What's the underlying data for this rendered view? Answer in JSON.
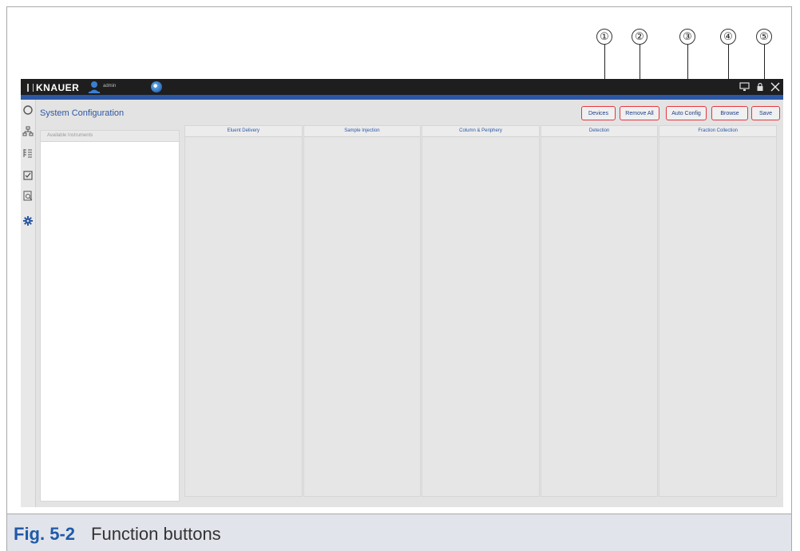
{
  "callouts": [
    "①",
    "②",
    "③",
    "④",
    "⑤"
  ],
  "app": {
    "logo_text": "KNAUER",
    "user_label": "admin",
    "page_title": "System Configuration"
  },
  "titlebar_icons": [
    "monitor-icon",
    "lock-icon",
    "close-icon"
  ],
  "left_rail_icons": [
    "circle-icon",
    "network-icon",
    "method-list-icon",
    "checkbox-icon",
    "search-report-icon",
    "gear-icon"
  ],
  "buttons": {
    "devices": "Devices",
    "remove_all": "Remove All",
    "auto_config": "Auto Config",
    "browse": "Browse",
    "save": "Save"
  },
  "available_panel": {
    "header": "Available Instruments"
  },
  "columns": [
    "Eluent Delivery",
    "Sample Injection",
    "Column & Periphery",
    "Detection",
    "Fraction Collection"
  ],
  "caption": {
    "fig": "Fig. 5-2",
    "text": "Function buttons"
  },
  "colors": {
    "accent": "#2c57a4",
    "highlight_border": "#e8343c",
    "caption_fig": "#1f5aa8"
  }
}
